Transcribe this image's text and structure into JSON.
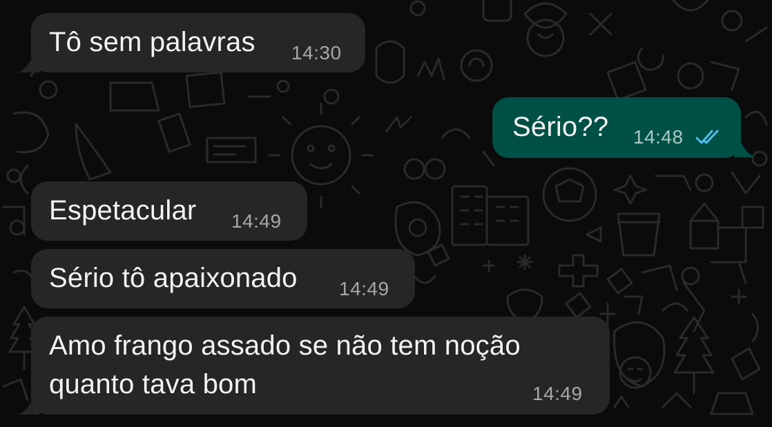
{
  "theme": {
    "incoming_bubble_color": "#262627",
    "outgoing_bubble_color": "#005046",
    "read_tick_color": "#53bdeb"
  },
  "messages": [
    {
      "direction": "incoming",
      "text": "Tô sem palavras",
      "time": "14:30"
    },
    {
      "direction": "outgoing",
      "text": "Sério??",
      "time": "14:48",
      "status": "read-double-check-icon"
    },
    {
      "direction": "incoming",
      "text": "Espetacular",
      "time": "14:49"
    },
    {
      "direction": "incoming",
      "text": "Sério tô apaixonado",
      "time": "14:49"
    },
    {
      "direction": "incoming",
      "text_lines": [
        "Amo frango assado se não tem noção",
        "quanto tava bom"
      ],
      "time": "14:49"
    }
  ]
}
